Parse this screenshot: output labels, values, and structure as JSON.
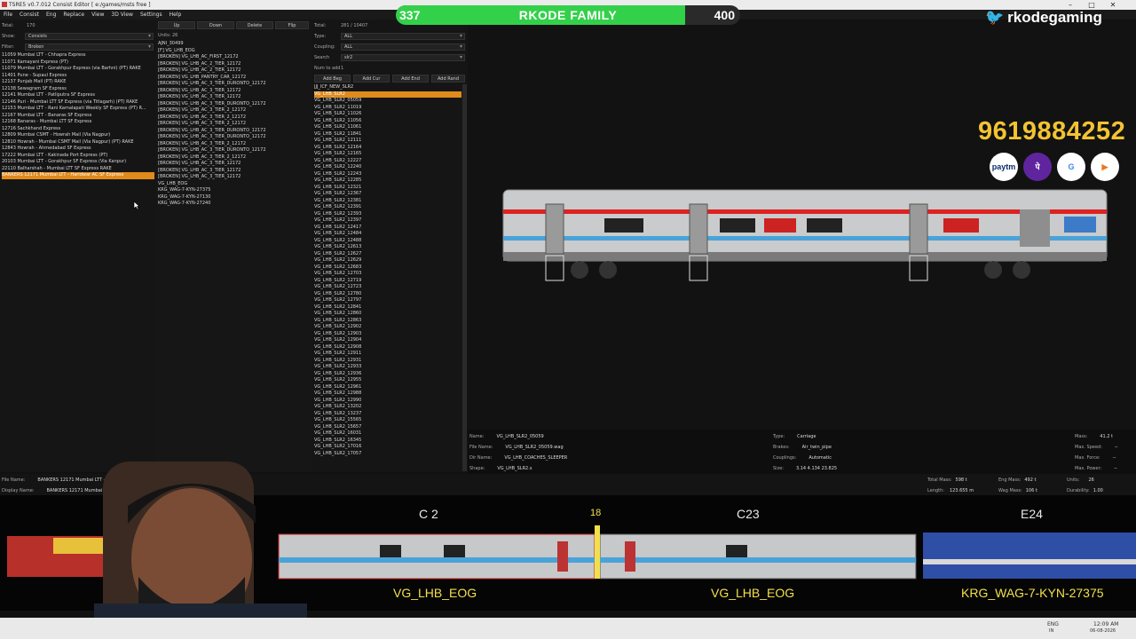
{
  "window": {
    "title": "TSRE5 v0.7.012 Consist Editor [ e:/games/msts free ]"
  },
  "menu": [
    "File",
    "Consist",
    "Eng",
    "Replace",
    "View",
    "3D View",
    "Settings",
    "Help"
  ],
  "left": {
    "total_label": "Total:",
    "total_value": "170",
    "show_label": "Show:",
    "show_value": "Consists",
    "filter_label": "Filter:",
    "filter_value": "Broken",
    "consists": [
      "11059 Mumbai LTT - Chhapra Express",
      "11071 Kamayani Express (PT)",
      "11079 Mumbai LTT - Gorakhpur Express (via Barhni) (PT) RAKE",
      "11401 Pune - Supaul Express",
      "12137 Punjab Mail (PT) RAKE",
      "12138 Sewagram SF Express",
      "12141 Mumbai LTT - Patliputra SF Express",
      "12146 Puri - Mumbai LTT SF Express (via Titlagarh) (PT) RAKE",
      "12153 Mumbai LTT - Rani Kamalapati Weekly SF Express (PT) R...",
      "12167 Mumbai LTT - Banaras SF Express",
      "12168 Banaras - Mumbai LTT SF Express",
      "12716 Sachkhand Express",
      "12809 Mumbai CSMT - Howrah Mail (Via Nagpur)",
      "12810 Howrah - Mumbai CSMT Mail (Via Nagpur) (PT) RAKE",
      "12843 Howrah - Ahmedabad SF Express",
      "17222 Mumbai LTT - Kakinada Port Express (PT)",
      "20103 Mumbai LTT - Gorakhpur SF Express (Via Kanpur)",
      "22110 Balharshah - Mumbai LTT SF Express RAKE",
      "BANKERS 12171 Mumbai LTT - Haridwar AC SF Express"
    ]
  },
  "middle": {
    "buttons": [
      "Up",
      "Down",
      "Delete",
      "Flip"
    ],
    "units_label": "Units:",
    "units_value": "26",
    "units": [
      "AJNI_30499",
      "[F] VG_LHB_EOG",
      "[BROKEN] VG_LHB_AC_FIRST_12172",
      "[BROKEN] VG_LHB_AC_2_TIER_12172",
      "[BROKEN] VG_LHB_AC_2_TIER_12172",
      "[BROKEN] VG_LHB_PANTRY_CAR_12172",
      "[BROKEN] VG_LHB_AC_3_TIER_DURONTO_12172",
      "[BROKEN] VG_LHB_AC_3_TIER_12172",
      "[BROKEN] VG_LHB_AC_3_TIER_12172",
      "[BROKEN] VG_LHB_AC_3_TIER_DURONTO_12172",
      "[BROKEN] VG_LHB_AC_3_TIER_2_12172",
      "[BROKEN] VG_LHB_AC_3_TIER_2_12172",
      "[BROKEN] VG_LHB_AC_3_TIER_2_12172",
      "[BROKEN] VG_LHB_AC_3_TIER_DURONTO_12172",
      "[BROKEN] VG_LHB_AC_3_TIER_DURONTO_12172",
      "[BROKEN] VG_LHB_AC_3_TIER_2_12172",
      "[BROKEN] VG_LHB_AC_3_TIER_DURONTO_12172",
      "[BROKEN] VG_LHB_AC_3_TIER_2_12172",
      "[BROKEN] VG_LHB_AC_3_TIER_12172",
      "[BROKEN] VG_LHB_AC_3_TIER_12172",
      "[BROKEN] VG_LHB_AC_3_TIER_12172",
      "VG_LHB_EOG",
      "KRG_WAG-7-KYN-27375",
      "KRG_WAG-7-KYN-27130",
      "KRG_WAG-7-KYN-27240"
    ]
  },
  "right": {
    "total_label": "Total:",
    "total_value": "281 / 10407",
    "type_label": "Type:",
    "type_value": "ALL",
    "coupling_label": "Coupling:",
    "coupling_value": "ALL",
    "search_label": "Search",
    "search_value": "slr2",
    "num_label": "Num to add",
    "num_value": "1",
    "buttons": [
      "Add Beg",
      "Add Cur",
      "Add End",
      "Add Rand"
    ],
    "items": [
      "JJJ_ICF_NEW_SLR2",
      "VG_LHB_SLR2",
      "VG_LHB_SLR2_05059",
      "VG_LHB_SLR2_11019",
      "VG_LHB_SLR2_11026",
      "VG_LHB_SLR2_11056",
      "VG_LHB_SLR2_11061",
      "VG_LHB_SLR2_11841",
      "VG_LHB_SLR2_12111",
      "VG_LHB_SLR2_12164",
      "VG_LHB_SLR2_12165",
      "VG_LHB_SLR2_12227",
      "VG_LHB_SLR2_12240",
      "VG_LHB_SLR2_12243",
      "VG_LHB_SLR2_12285",
      "VG_LHB_SLR2_12321",
      "VG_LHB_SLR2_12367",
      "VG_LHB_SLR2_12381",
      "VG_LHB_SLR2_12391",
      "VG_LHB_SLR2_12393",
      "VG_LHB_SLR2_12397",
      "VG_LHB_SLR2_12417",
      "VG_LHB_SLR2_12484",
      "VG_LHB_SLR2_12488",
      "VG_LHB_SLR2_12613",
      "VG_LHB_SLR2_12627",
      "VG_LHB_SLR2_12629",
      "VG_LHB_SLR2_12683",
      "VG_LHB_SLR2_12703",
      "VG_LHB_SLR2_12719",
      "VG_LHB_SLR2_12723",
      "VG_LHB_SLR2_12780",
      "VG_LHB_SLR2_12797",
      "VG_LHB_SLR2_12841",
      "VG_LHB_SLR2_12860",
      "VG_LHB_SLR2_12863",
      "VG_LHB_SLR2_12902",
      "VG_LHB_SLR2_12903",
      "VG_LHB_SLR2_12904",
      "VG_LHB_SLR2_12908",
      "VG_LHB_SLR2_12911",
      "VG_LHB_SLR2_12931",
      "VG_LHB_SLR2_12933",
      "VG_LHB_SLR2_12936",
      "VG_LHB_SLR2_12955",
      "VG_LHB_SLR2_12961",
      "VG_LHB_SLR2_12988",
      "VG_LHB_SLR2_12990",
      "VG_LHB_SLR2_13202",
      "VG_LHB_SLR2_13237",
      "VG_LHB_SLR2_15565",
      "VG_LHB_SLR2_15657",
      "VG_LHB_SLR2_16031",
      "VG_LHB_SLR2_16345",
      "VG_LHB_SLR2_17016",
      "VG_LHB_SLR2_17057"
    ]
  },
  "overlay": {
    "score_left": "337",
    "score_title": "RKODE FAMILY",
    "score_right": "400",
    "score_fill": 0.84,
    "handle": "rkodegaming",
    "phone": "9619884252",
    "pay_icons": [
      "paytm",
      "phonepe",
      "gpay",
      "bhim"
    ]
  },
  "props": {
    "name_label": "Name:",
    "name_value": "VG_LHB_SLR2_05059",
    "file_label": "File Name:",
    "file_value": "VG_LHB_SLR2_05059.wag",
    "dir_label": "Dir Name:",
    "dir_value": "VG_LHB_COACHES_SLEEPER",
    "shape_label": "Shape:",
    "shape_value": "VG_LHB_SLR2.s",
    "type_label": "Type:",
    "type_value": "Carriage",
    "brakes_label": "Brakes:",
    "brakes_value": "Air_twin_pipe",
    "coupling_label": "Couplings:",
    "coupling_value": "Automatic",
    "size_label": "Size:",
    "size_value": "3.14 4.134 23.825",
    "mass_label": "Mass:",
    "mass_value": "41.2 t",
    "maxspeed_label": "Max. Speed:",
    "maxspeed_value": "--",
    "maxforce_label": "Max. Force:",
    "maxforce_value": "--",
    "maxpower_label": "Max. Power:",
    "maxpower_value": "--"
  },
  "consist": {
    "file_label": "File Name:",
    "file_value": "BANKERS 12171 Mumbai LTT - Haridv",
    "display_label": "Display Name:",
    "display_value": "BANKERS 12171 Mumbai LTT - Haridv",
    "totalmass_label": "Total Mass:",
    "totalmass_value": "598 t",
    "engmass_label": "Eng Mass:",
    "engmass_value": "492 t",
    "units_label": "Units:",
    "units_value": "26",
    "length_label": "Length:",
    "length_value": "123.655 m",
    "wagmass_label": "Wag Mass:",
    "wagmass_value": "106 t",
    "durability_label": "Durability:",
    "durability_value": "1.00"
  },
  "strip": {
    "cars": [
      {
        "tag": "C 2",
        "name": "VG_LHB_EOG"
      },
      {
        "tag": "C23",
        "name": "VG_LHB_EOG"
      },
      {
        "tag": "E24",
        "name": "KRG_WAG-7-KYN-27375"
      }
    ],
    "marker": "18"
  },
  "taskbar": {
    "lang": "ENG",
    "lang2": "IN",
    "time": "12:09 AM",
    "date": "06-08-2026"
  }
}
